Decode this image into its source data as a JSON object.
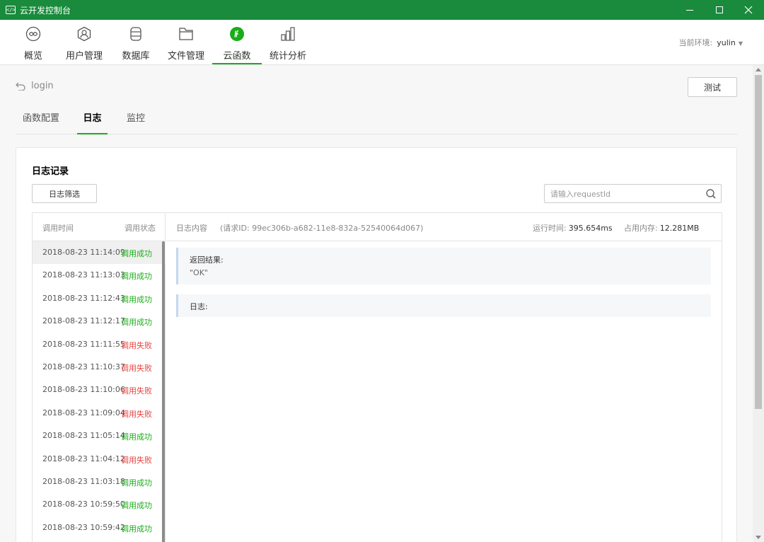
{
  "window": {
    "title": "云开发控制台"
  },
  "nav": {
    "items": [
      {
        "label": "概览",
        "icon": "overview-icon"
      },
      {
        "label": "用户管理",
        "icon": "user-icon"
      },
      {
        "label": "数据库",
        "icon": "database-icon"
      },
      {
        "label": "文件管理",
        "icon": "folder-icon"
      },
      {
        "label": "云函数",
        "icon": "cloud-function-icon",
        "active": true
      },
      {
        "label": "统计分析",
        "icon": "chart-icon"
      }
    ],
    "env_label": "当前环境:",
    "env_value": "yulin"
  },
  "page": {
    "function_name": "login",
    "test_button": "测试",
    "tabs": [
      "函数配置",
      "日志",
      "监控"
    ],
    "active_tab": "日志"
  },
  "log_card": {
    "title": "日志记录",
    "filter_button": "日志筛选",
    "search_placeholder": "请输入requestId",
    "columns": {
      "time": "调用时间",
      "status": "调用状态"
    },
    "rows": [
      {
        "time": "2018-08-23 11:14:09",
        "status": "调用成功",
        "ok": true
      },
      {
        "time": "2018-08-23 11:13:03",
        "status": "调用成功",
        "ok": true
      },
      {
        "time": "2018-08-23 11:12:43",
        "status": "调用成功",
        "ok": true
      },
      {
        "time": "2018-08-23 11:12:17",
        "status": "调用成功",
        "ok": true
      },
      {
        "time": "2018-08-23 11:11:55",
        "status": "调用失败",
        "ok": false
      },
      {
        "time": "2018-08-23 11:10:37",
        "status": "调用失败",
        "ok": false
      },
      {
        "time": "2018-08-23 11:10:06",
        "status": "调用失败",
        "ok": false
      },
      {
        "time": "2018-08-23 11:09:04",
        "status": "调用失败",
        "ok": false
      },
      {
        "time": "2018-08-23 11:05:14",
        "status": "调用成功",
        "ok": true
      },
      {
        "time": "2018-08-23 11:04:12",
        "status": "调用失败",
        "ok": false
      },
      {
        "time": "2018-08-23 11:03:18",
        "status": "调用成功",
        "ok": true
      },
      {
        "time": "2018-08-23 10:59:50",
        "status": "调用成功",
        "ok": true
      },
      {
        "time": "2018-08-23 10:59:42",
        "status": "调用成功",
        "ok": true
      }
    ],
    "detail": {
      "label": "日志内容",
      "request_id_text": "(请求ID: 99ec306b-a682-11e8-832a-52540064d067)",
      "run_time_label": "运行时间:",
      "run_time_value": "395.654ms",
      "memory_label": "占用内存:",
      "memory_value": "12.281MB",
      "result_title": "返回结果:",
      "result_value": "\"OK\"",
      "logs_title": "日志:"
    }
  },
  "colors": {
    "titlebar": "#1a8b3c",
    "accent": "#1aad19",
    "success": "#1aad19",
    "fail": "#e64340"
  }
}
